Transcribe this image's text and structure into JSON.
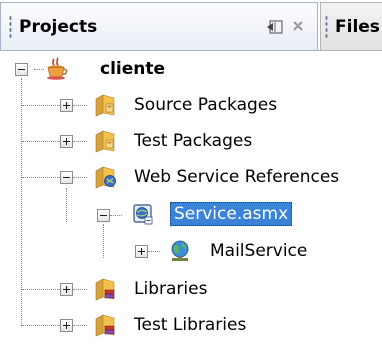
{
  "tabs": {
    "projects_label": "Projects",
    "files_label": "Files",
    "minimize_icon": "minimize-icon",
    "close_icon": "close-icon"
  },
  "tree": {
    "root": {
      "label": "cliente",
      "icon": "coffee-cup-icon",
      "expanded": true
    },
    "items": [
      {
        "label": "Source Packages",
        "icon": "package-folder-icon",
        "expanded": false
      },
      {
        "label": "Test Packages",
        "icon": "package-folder-icon",
        "expanded": false
      },
      {
        "label": "Web Service References",
        "icon": "web-service-folder-icon",
        "expanded": true
      },
      {
        "label": "Service.asmx",
        "icon": "web-service-reference-icon",
        "expanded": true,
        "selected": true
      },
      {
        "label": "MailService",
        "icon": "globe-service-icon",
        "expanded": false
      },
      {
        "label": "Libraries",
        "icon": "library-folder-icon",
        "expanded": false
      },
      {
        "label": "Test Libraries",
        "icon": "library-folder-icon",
        "expanded": false
      }
    ]
  },
  "colors": {
    "selection": "#3a83d8",
    "tab_border": "#a9b6c9",
    "folder": "#f0c24a"
  }
}
